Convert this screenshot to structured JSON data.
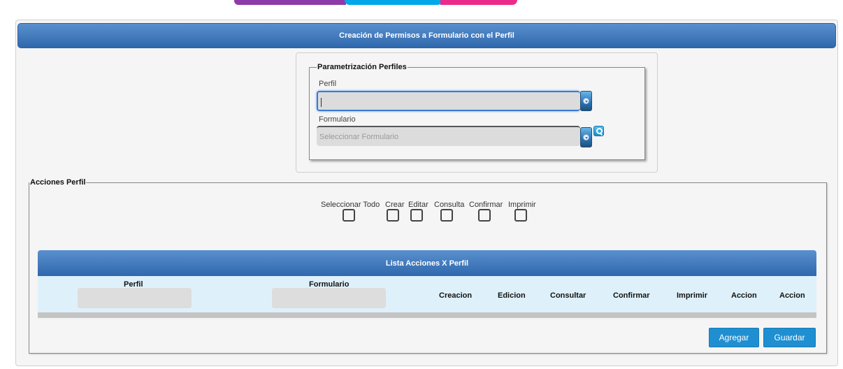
{
  "page": {
    "title": "Creación de Permisos a Formulario con el Perfil"
  },
  "param_section": {
    "legend": "Parametrización Perfiles",
    "perfil": {
      "label": "Perfil",
      "value": ""
    },
    "formulario": {
      "label": "Formulario",
      "placeholder": "Seleccionar Formulario"
    }
  },
  "acciones_section": {
    "legend": "Acciones Perfil",
    "checkboxes": [
      {
        "label": "Seleccionar Todo",
        "checked": false
      },
      {
        "label": "Crear",
        "checked": false
      },
      {
        "label": "Editar",
        "checked": false
      },
      {
        "label": "Consulta",
        "checked": false
      },
      {
        "label": "Confirmar",
        "checked": false
      },
      {
        "label": "Imprimir",
        "checked": false
      }
    ]
  },
  "lista": {
    "title": "Lista Acciones X Perfil",
    "columns": [
      "Perfil",
      "Formulario",
      "Creacion",
      "Edicion",
      "Consultar",
      "Confirmar",
      "Imprimir",
      "Accion",
      "Accion"
    ],
    "rows": []
  },
  "buttons": {
    "agregar": "Agregar",
    "guardar": "Guardar"
  },
  "colors": {
    "header_blue": "#2f68ad",
    "button_blue": "#1f8fd2",
    "brand_purple": "#8e3aa8",
    "brand_cyan": "#00a8e8",
    "brand_pink": "#ec2a8c"
  },
  "icons": [
    "dropdown-icon",
    "search-icon"
  ]
}
